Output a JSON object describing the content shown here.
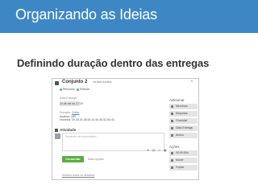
{
  "slide": {
    "title": "Organizando as Ideias",
    "subtitle": "Definindo duração dentro das entregas",
    "header_color": "#3d87c5"
  },
  "card": {
    "title": "Conjunto 2",
    "list_info": "na lista Aceitos",
    "tabs": [
      "Recursos",
      "Estimar"
    ],
    "due_label": "Data Entrega",
    "due_date": "24 de set às 17:30",
    "duration_label": "Duração:",
    "duration_link": "Editar",
    "estimate_line": "Acabou: 150",
    "hours_line": "Horários: 30,30,31,46,51,42,44,45,52,54,43",
    "activity_heading": "Atividade",
    "comment_placeholder": "Escrever um comentário...",
    "comment_tools": "⊕ @ ☺ ▣",
    "comment_button": "Comentar",
    "comment_hint": "Mais opções",
    "details_link": "Mostrar todos os detalhes",
    "close_icon": "×"
  },
  "sidebar": {
    "add_heading": "Adicionar",
    "add_items": [
      "Membros",
      "Etiquetas",
      "Checklist",
      "Data Entrega",
      "Anexo"
    ],
    "actions_heading": "Ações",
    "action_items": [
      "00:00:00b",
      "Mover",
      "Copiar"
    ]
  },
  "colors": {
    "comment_button": "#5aac44",
    "link": "#4a86b8"
  }
}
